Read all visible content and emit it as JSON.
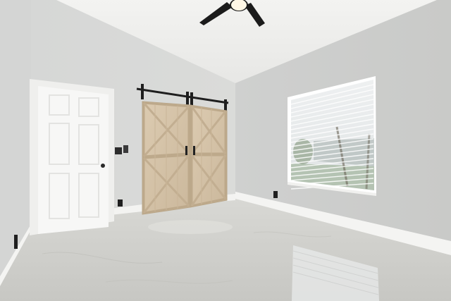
{
  "scene": {
    "description_visible_text": [],
    "palette": {
      "ceiling": "#f1f1ef",
      "wall_left": "#d6d7d6",
      "wall_back": "#d9dad9",
      "wall_right": "#cfd0ce",
      "floor": "#cfcfcb",
      "baseboard": "#f4f4f2",
      "door": "#f6f6f5",
      "barn_wood": "#d7c7ae",
      "fan_black": "#1b1b1b",
      "window_frame": "#ffffff"
    },
    "icons": [
      "ceiling-fan-icon",
      "barn-door-hardware-icon",
      "door-knob-icon",
      "light-switch-icon",
      "outlet-icon",
      "window-blinds-icon"
    ]
  }
}
